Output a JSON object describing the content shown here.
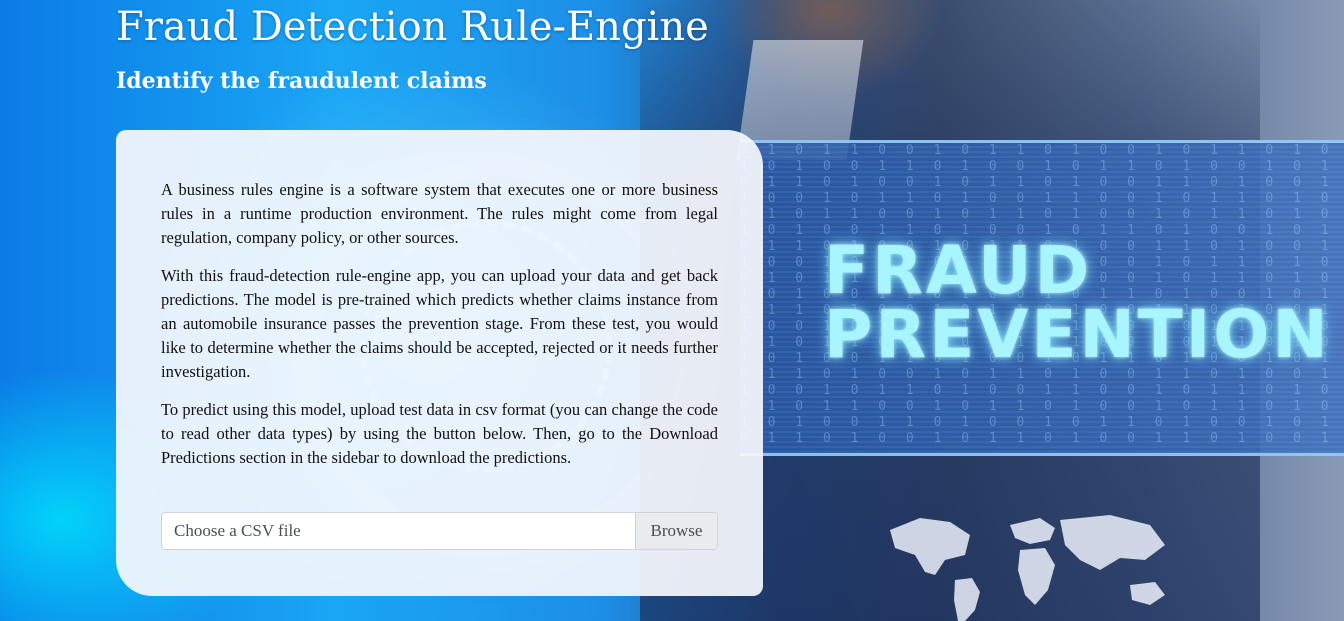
{
  "header": {
    "title": "Fraud Detection Rule-Engine",
    "subtitle": "Identify the fraudulent claims"
  },
  "background": {
    "banner_text": "FRAUD\nPREVENTION",
    "accent_color": "#a8f4ff"
  },
  "card": {
    "paragraphs": [
      "A business rules engine is a software system that executes one or more business rules in a runtime production environment. The rules might come from legal regulation, company policy, or other sources.",
      "With this fraud-detection rule-engine app, you can upload your data and get back predictions. The model is pre-trained which predicts whether claims instance from an automobile insurance passes the prevention stage. From these test, you would like to determine whether the claims should be accepted, rejected or it needs further investigation.",
      "To predict using this model, upload test data in csv format (you can change the code to read other data types) by using the button below. Then, go to the Download Predictions section in the sidebar to download the predictions."
    ],
    "file_uploader": {
      "placeholder": "Choose a CSV file",
      "button_label": "Browse"
    }
  }
}
